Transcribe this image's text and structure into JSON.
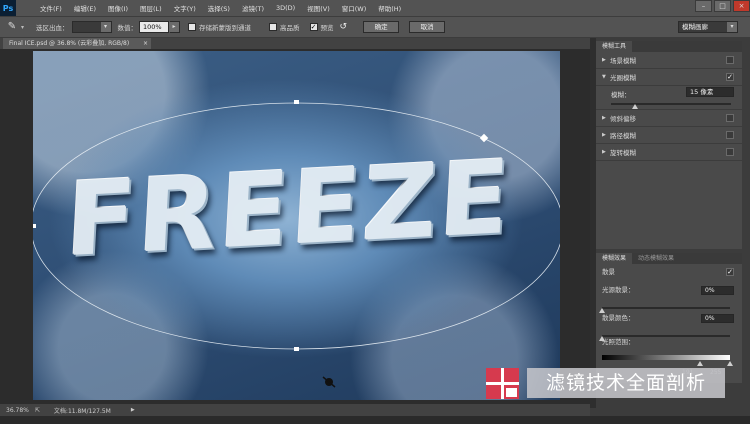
{
  "app": {
    "logo": "Ps"
  },
  "menu": [
    "文件(F)",
    "编辑(E)",
    "图像(I)",
    "图层(L)",
    "文字(Y)",
    "选择(S)",
    "滤镜(T)",
    "3D(D)",
    "视图(V)",
    "窗口(W)",
    "帮助(H)"
  ],
  "window_controls": {
    "minimize": "–",
    "maximize": "□",
    "close": "×"
  },
  "options": {
    "output_label": "选区出血：",
    "density_label": "数值：",
    "density_value": "100%",
    "save_mask_label": "存储新蒙版到通道",
    "high_quality_label": "高品质",
    "preview_label": "预览",
    "preview_checked": true,
    "ok_label": "确定",
    "cancel_label": "取消",
    "workspace": "模糊画廊"
  },
  "document": {
    "tab_title": "Final ICE.psd @ 36.8% (云彩叠加, RGB/8)",
    "canvas_text": "FREEZE",
    "zoom": "36.78%",
    "doc_size": "文档:11.8M/127.5M"
  },
  "blur_tools": {
    "panel_title": "模糊工具",
    "items": [
      {
        "label": "场景模糊",
        "checked": false,
        "expanded": false
      },
      {
        "label": "光圈模糊",
        "checked": true,
        "expanded": true
      },
      {
        "label": "倾斜偏移",
        "checked": false,
        "expanded": false
      },
      {
        "label": "路径模糊",
        "checked": false,
        "expanded": false
      },
      {
        "label": "旋转模糊",
        "checked": false,
        "expanded": false
      }
    ],
    "blur_label": "模糊：",
    "blur_value": "15 像素",
    "blur_level": 0.2
  },
  "effects": {
    "tabs": [
      "模糊效果",
      "动态模糊效果"
    ],
    "bokeh_label": "散景",
    "bokeh_checked": true,
    "light_bokeh_label": "光源散景：",
    "light_bokeh_value": "0%",
    "bokeh_color_label": "散景颜色：",
    "bokeh_color_value": "0%",
    "light_range_label": "光照范围：",
    "light_range_values": [
      "191",
      "255"
    ]
  },
  "watermark": {
    "text": "滤镜技术全面剖析"
  },
  "colors": {
    "watermark_red": "#d63a4e",
    "accent_blue": "#31a8ff"
  }
}
